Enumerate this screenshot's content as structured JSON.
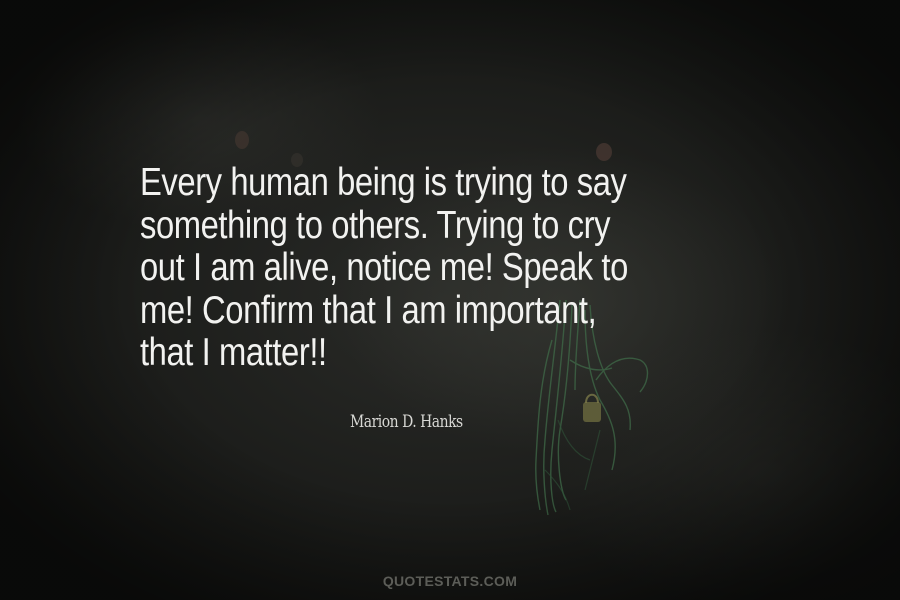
{
  "quote": {
    "lines": [
      "Every human being is trying to say",
      "something to others. Trying to cry",
      "out I am alive, notice me! Speak to",
      "me! Confirm that I am important,",
      "that I matter!!"
    ]
  },
  "author": "Marion D. Hanks",
  "watermark": "QUOTESTATS.COM"
}
